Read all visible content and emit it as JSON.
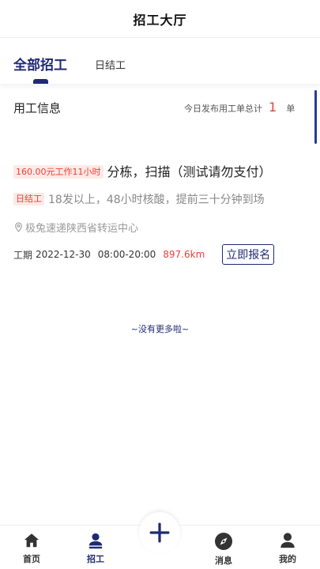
{
  "header": {
    "title": "招工大厅"
  },
  "tabs": [
    {
      "label": "全部招工",
      "active": true
    },
    {
      "label": "日结工",
      "active": false
    }
  ],
  "info": {
    "title": "用工信息",
    "summary_prefix": "今日发布用工单总计",
    "count": "1",
    "unit": "单"
  },
  "job": {
    "pay_tag": "160.00元工作11小时",
    "title": "分栋，扫描（测试请勿支付）",
    "type_tag": "日结工",
    "description": "18发以上，48小时核酸，提前三十分钟到场",
    "location": "极兔速递陕西省转运中心",
    "period_label": "工期",
    "date": "2022-12-30",
    "time": "08:00-20:00",
    "distance": "897.6km",
    "apply_label": "立即报名"
  },
  "list_end": "~没有更多啦~",
  "tabbar": [
    {
      "label": "首页",
      "icon": "home-icon"
    },
    {
      "label": "招工",
      "icon": "recruit-icon",
      "active": true
    },
    {
      "label": "",
      "icon": "plus-icon"
    },
    {
      "label": "消息",
      "icon": "compass-icon"
    },
    {
      "label": "我的",
      "icon": "user-icon"
    }
  ],
  "colors": {
    "primary": "#1f2a73",
    "accent_red": "#e8413b",
    "tag_bg": "#fde9e6"
  }
}
